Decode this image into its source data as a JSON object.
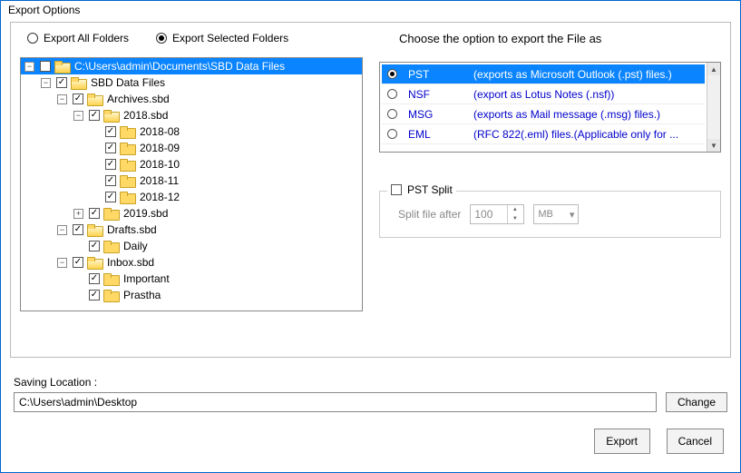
{
  "window": {
    "title": "Export Options"
  },
  "radios": {
    "all": {
      "label": "Export All Folders",
      "selected": false
    },
    "selected": {
      "label": "Export Selected Folders",
      "selected": true
    }
  },
  "rightHeading": "Choose the option to export the File as",
  "tree": [
    {
      "indent": 0,
      "expand": "minus",
      "checked": false,
      "open": true,
      "sel": true,
      "label": "C:\\Users\\admin\\Documents\\SBD Data Files"
    },
    {
      "indent": 1,
      "expand": "minus",
      "checked": true,
      "open": true,
      "sel": false,
      "label": "SBD Data Files"
    },
    {
      "indent": 2,
      "expand": "minus",
      "checked": true,
      "open": true,
      "sel": false,
      "label": "Archives.sbd"
    },
    {
      "indent": 3,
      "expand": "minus",
      "checked": true,
      "open": true,
      "sel": false,
      "label": "2018.sbd"
    },
    {
      "indent": 4,
      "expand": "none",
      "checked": true,
      "open": false,
      "sel": false,
      "label": "2018-08"
    },
    {
      "indent": 4,
      "expand": "none",
      "checked": true,
      "open": false,
      "sel": false,
      "label": "2018-09"
    },
    {
      "indent": 4,
      "expand": "none",
      "checked": true,
      "open": false,
      "sel": false,
      "label": "2018-10"
    },
    {
      "indent": 4,
      "expand": "none",
      "checked": true,
      "open": false,
      "sel": false,
      "label": "2018-11"
    },
    {
      "indent": 4,
      "expand": "none",
      "checked": true,
      "open": false,
      "sel": false,
      "label": "2018-12"
    },
    {
      "indent": 3,
      "expand": "plus",
      "checked": true,
      "open": false,
      "sel": false,
      "label": "2019.sbd"
    },
    {
      "indent": 2,
      "expand": "minus",
      "checked": true,
      "open": true,
      "sel": false,
      "label": "Drafts.sbd"
    },
    {
      "indent": 3,
      "expand": "none",
      "checked": true,
      "open": false,
      "sel": false,
      "label": "Daily"
    },
    {
      "indent": 2,
      "expand": "minus",
      "checked": true,
      "open": true,
      "sel": false,
      "label": "Inbox.sbd"
    },
    {
      "indent": 3,
      "expand": "none",
      "checked": true,
      "open": false,
      "sel": false,
      "label": "Important"
    },
    {
      "indent": 3,
      "expand": "none",
      "checked": true,
      "open": false,
      "sel": false,
      "label": "Prastha"
    }
  ],
  "formats": [
    {
      "name": "PST",
      "desc": "(exports as Microsoft Outlook (.pst) files.)",
      "selected": true
    },
    {
      "name": "NSF",
      "desc": "(export as Lotus Notes (.nsf))",
      "selected": false
    },
    {
      "name": "MSG",
      "desc": "(exports as Mail message (.msg) files.)",
      "selected": false
    },
    {
      "name": "EML",
      "desc": "(RFC 822(.eml) files.(Applicable only for ...",
      "selected": false
    }
  ],
  "pstSplit": {
    "title": "PST Split",
    "checked": false,
    "label": "Split file after",
    "value": "100",
    "unit": "MB"
  },
  "saving": {
    "label": "Saving Location :",
    "path": "C:\\Users\\admin\\Desktop",
    "changeBtn": "Change"
  },
  "footer": {
    "export": "Export",
    "cancel": "Cancel"
  }
}
